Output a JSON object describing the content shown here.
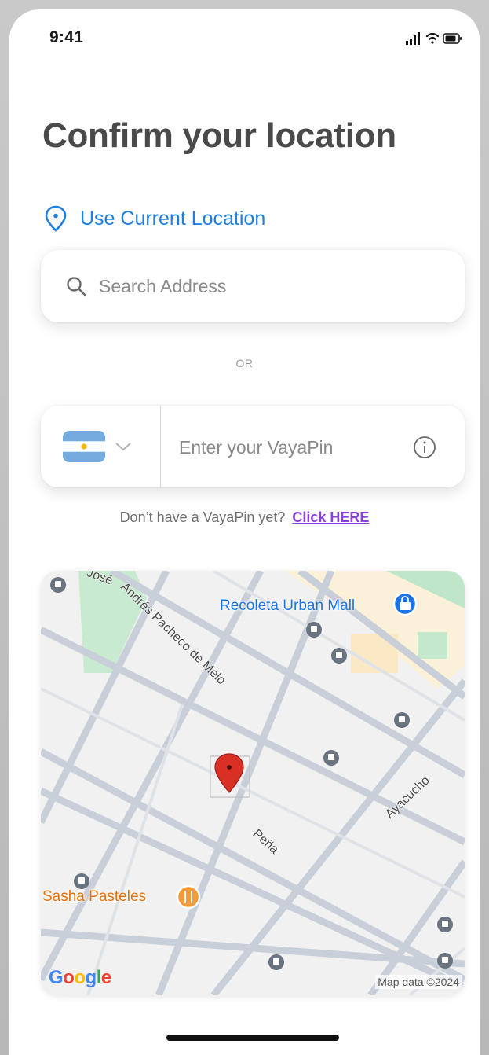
{
  "status_bar": {
    "time": "9:41"
  },
  "page": {
    "title": "Confirm your location",
    "use_current_location": "Use Current Location",
    "search_placeholder": "Search Address",
    "or_text": "OR",
    "vayapin_placeholder": "Enter your VayaPin",
    "no_pin_text": "Don’t have a VayaPin yet?",
    "click_here": "Click HERE"
  },
  "map": {
    "places": {
      "mall": "Recoleta Urban Mall",
      "restaurant": "Sasha Pasteles"
    },
    "streets": {
      "jose": "José",
      "andres": "Andrés Pacheco de Melo",
      "ayacucho": "Ayacucho",
      "pena": "Peña"
    },
    "provider": "Google",
    "attribution": "Map data ©2024"
  },
  "colors": {
    "accent": "#1e7fe0",
    "link": "#8a3fe0",
    "title": "#4a4a4a",
    "pin": "#d93025"
  },
  "icons": [
    "signal-icon",
    "wifi-icon",
    "battery-icon",
    "location-pin-icon",
    "search-icon",
    "argentina-flag-icon",
    "chevron-down-icon",
    "info-icon",
    "map-pin-icon",
    "bus-stop-icon",
    "shopping-icon",
    "restaurant-icon"
  ]
}
